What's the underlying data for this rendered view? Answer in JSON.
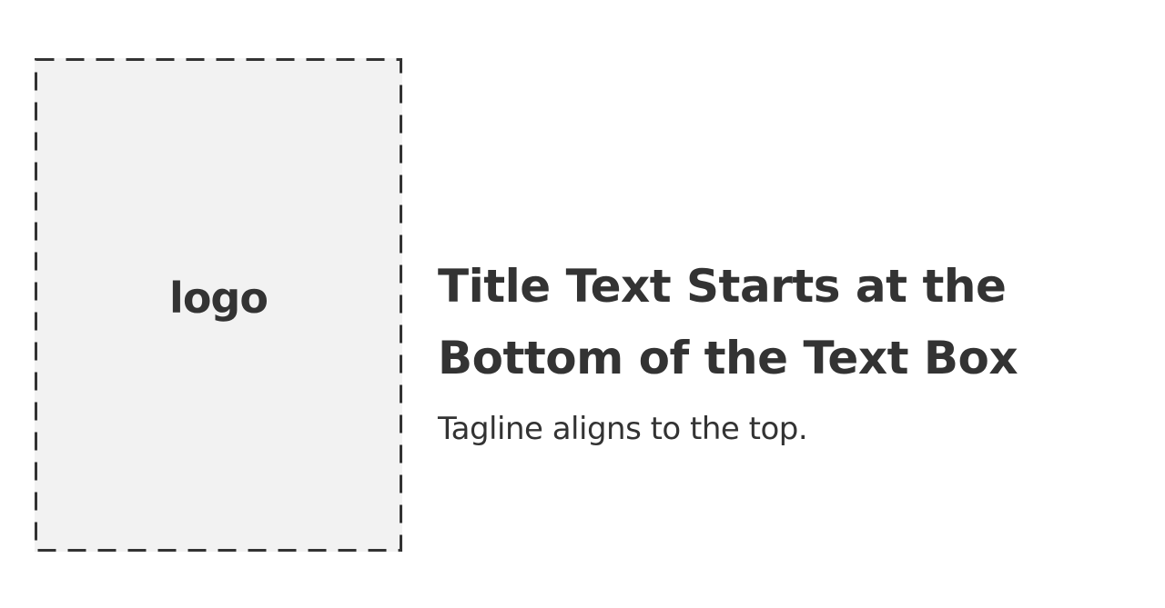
{
  "logo": {
    "label": "logo"
  },
  "title": {
    "line1": "Title Text Starts at the",
    "line2": "Bottom of the Text Box"
  },
  "tagline": "Tagline aligns to the top.",
  "colors": {
    "text": "#333333",
    "logo_fill": "#f2f2f2",
    "border": "#333333",
    "background": "#ffffff"
  }
}
